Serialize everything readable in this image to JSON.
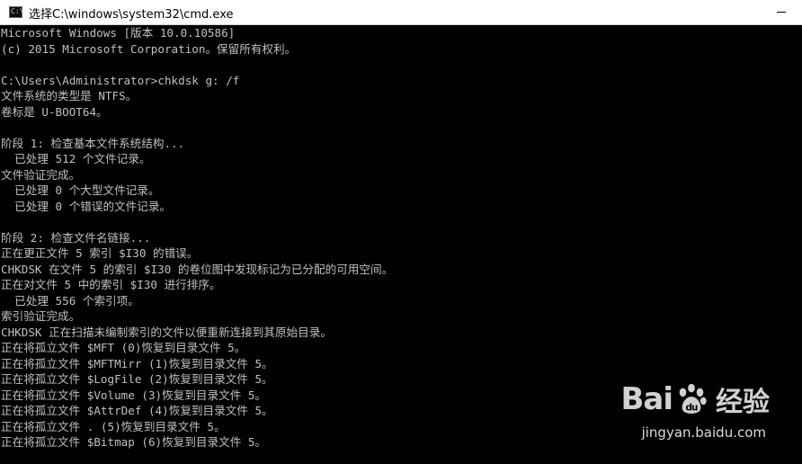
{
  "window": {
    "title": "选择C:\\windows\\system32\\cmd.exe",
    "icon": "cmd-icon",
    "icon_glyph": "C:\\"
  },
  "console": {
    "lines": [
      "Microsoft Windows [版本 10.0.10586]",
      "(c) 2015 Microsoft Corporation。保留所有权利。",
      "",
      "C:\\Users\\Administrator>chkdsk g: /f",
      "文件系统的类型是 NTFS。",
      "卷标是 U-BOOT64。",
      "",
      "阶段 1: 检查基本文件系统结构...",
      "  已处理 512 个文件记录。",
      "文件验证完成。",
      "  已处理 0 个大型文件记录。",
      "  已处理 0 个错误的文件记录。",
      "",
      "阶段 2: 检查文件名链接...",
      "正在更正文件 5 索引 $I30 的错误。",
      "CHKDSK 在文件 5 的索引 $I30 的卷位图中发现标记为已分配的可用空间。",
      "正在对文件 5 中的索引 $I30 进行排序。",
      "  已处理 556 个索引项。",
      "索引验证完成。",
      "CHKDSK 正在扫描未编制索引的文件以便重新连接到其原始目录。",
      "正在将孤立文件 $MFT (0)恢复到目录文件 5。",
      "正在将孤立文件 $MFTMirr (1)恢复到目录文件 5。",
      "正在将孤立文件 $LogFile (2)恢复到目录文件 5。",
      "正在将孤立文件 $Volume (3)恢复到目录文件 5。",
      "正在将孤立文件 $AttrDef (4)恢复到目录文件 5。",
      "正在将孤立文件 . (5)恢复到目录文件 5。",
      "正在将孤立文件 $Bitmap (6)恢复到目录文件 5。"
    ]
  },
  "watermark": {
    "logo_left": "Bai",
    "logo_right": "du",
    "logo_cn": "经验",
    "url": "jingyan.baidu.com"
  },
  "colors": {
    "console_bg": "#000000",
    "console_text": "#c0c0c0",
    "titlebar_bg": "#ffffff"
  }
}
